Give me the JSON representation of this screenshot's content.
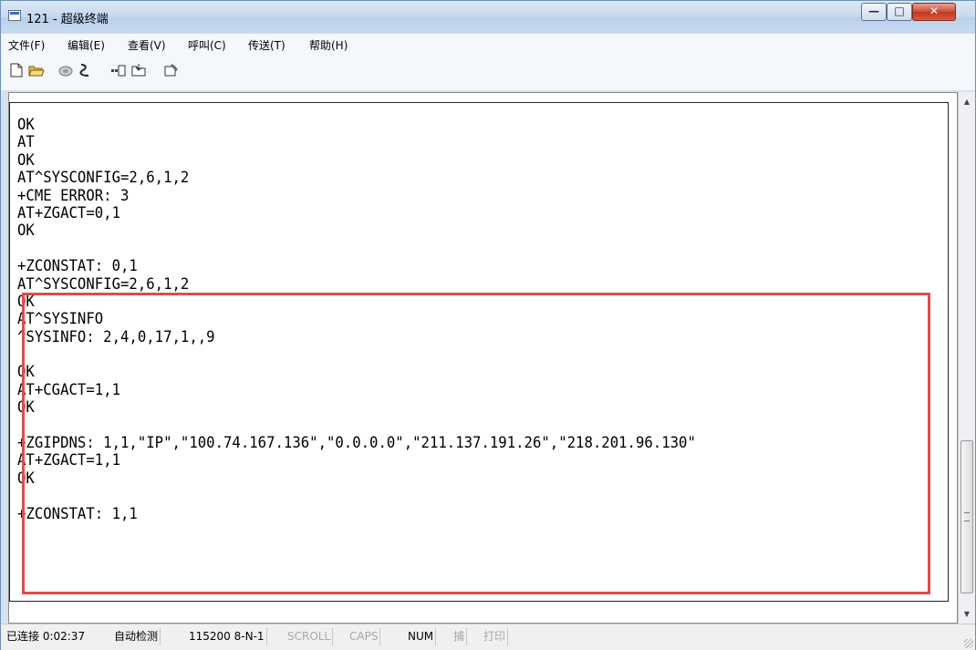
{
  "window": {
    "title": "121 - 超级终端"
  },
  "menu": [
    {
      "label": "文件(F)"
    },
    {
      "label": "编辑(E)"
    },
    {
      "label": "查看(V)"
    },
    {
      "label": "呼叫(C)"
    },
    {
      "label": "传送(T)"
    },
    {
      "label": "帮助(H)"
    }
  ],
  "toolbar": [
    {
      "icon": "new-document-icon"
    },
    {
      "icon": "open-folder-icon"
    },
    {
      "icon": "dial-icon"
    },
    {
      "icon": "disconnect-icon"
    },
    {
      "icon": "send-icon"
    },
    {
      "icon": "receive-icon"
    },
    {
      "icon": "properties-icon"
    }
  ],
  "terminal": {
    "lines": [
      "OK",
      "AT",
      "OK",
      "AT^SYSCONFIG=2,6,1,2",
      "+CME ERROR: 3",
      "AT+ZGACT=0,1",
      "OK",
      "",
      "+ZCONSTAT: 0,1",
      "AT^SYSCONFIG=2,6,1,2",
      "OK",
      "AT^SYSINFO",
      "^SYSINFO: 2,4,0,17,1,,9",
      "",
      "OK",
      "AT+CGACT=1,1",
      "OK",
      "",
      "+ZGIPDNS: 1,1,\"IP\",\"100.74.167.136\",\"0.0.0.0\",\"211.137.191.26\",\"218.201.96.130\"",
      "AT+ZGACT=1,1",
      "OK",
      "",
      "+ZCONSTAT: 1,1"
    ],
    "highlight_color": "#e34b4b"
  },
  "status": {
    "connection": "已连接 0:02:37",
    "detect": "自动检测",
    "port": "115200 8-N-1",
    "scroll": "SCROLL",
    "caps": "CAPS",
    "num": "NUM",
    "capture": "捕",
    "print": "打印"
  }
}
